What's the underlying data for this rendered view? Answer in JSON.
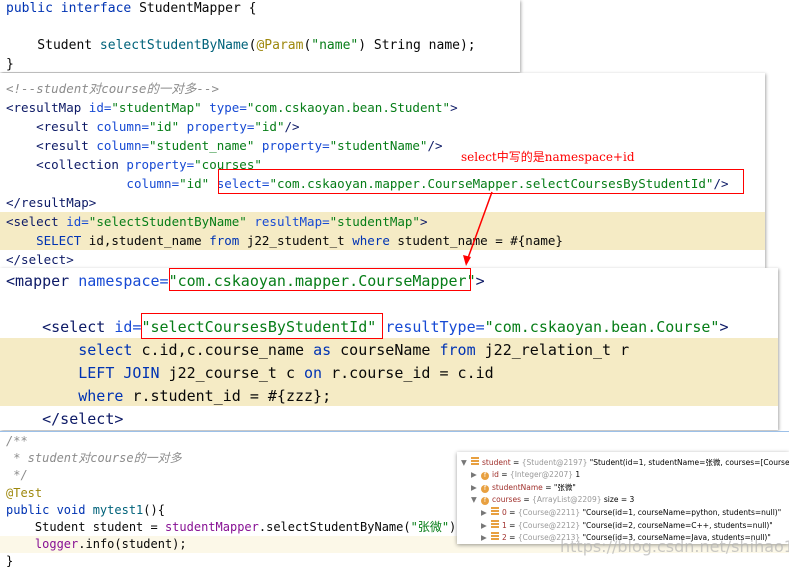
{
  "panels": [
    {
      "id": "java-interface",
      "lines": [
        [
          [
            "public interface ",
            "k"
          ],
          [
            "StudentMapper {",
            "p"
          ]
        ],
        [],
        [
          [
            "    Student ",
            "p"
          ],
          [
            "selectStudentByName",
            "m"
          ],
          [
            "(",
            "p"
          ],
          [
            "@Param",
            "an"
          ],
          [
            "(",
            "p"
          ],
          [
            "\"name\"",
            "s"
          ],
          [
            ") String name);",
            "p"
          ]
        ],
        [
          [
            "}",
            "p"
          ]
        ]
      ]
    },
    {
      "id": "xml-resultmap",
      "lines": [
        [
          [
            "<!--student对course的一对多-->",
            "c"
          ]
        ],
        [
          [
            "<resultMap ",
            "t"
          ],
          [
            "id=",
            "a"
          ],
          [
            "\"studentMap\" ",
            "s"
          ],
          [
            "type=",
            "a"
          ],
          [
            "\"com.cskaoyan.bean.Student\"",
            "s"
          ],
          [
            ">",
            "t"
          ]
        ],
        [
          [
            "    <result ",
            "t"
          ],
          [
            "column=",
            "a"
          ],
          [
            "\"id\" ",
            "s"
          ],
          [
            "property=",
            "a"
          ],
          [
            "\"id\"",
            "s"
          ],
          [
            "/>",
            "t"
          ]
        ],
        [
          [
            "    <result ",
            "t"
          ],
          [
            "column=",
            "a"
          ],
          [
            "\"student_name\" ",
            "s"
          ],
          [
            "property=",
            "a"
          ],
          [
            "\"studentName\"",
            "s"
          ],
          [
            "/>",
            "t"
          ]
        ],
        [
          [
            "    <collection ",
            "t"
          ],
          [
            "property=",
            "a"
          ],
          [
            "\"courses\"",
            "s"
          ]
        ],
        [
          [
            "                ",
            "p"
          ],
          [
            "column=",
            "a"
          ],
          [
            "\"id\" ",
            "s"
          ],
          [
            "select=",
            "a"
          ],
          [
            "\"com.cskaoyan.mapper.CourseMapper.selectCoursesByStudentId\"",
            "s"
          ],
          [
            "/>",
            "t"
          ]
        ],
        [
          [
            "</resultMap>",
            "t"
          ]
        ],
        [
          [
            "<select ",
            "t"
          ],
          [
            "id=",
            "a"
          ],
          [
            "\"selectStudentByName\" ",
            "s"
          ],
          [
            "resultMap=",
            "a"
          ],
          [
            "\"studentMap\"",
            "s"
          ],
          [
            ">",
            "t"
          ]
        ],
        [
          [
            "    SELECT ",
            "k"
          ],
          [
            "id,student_name ",
            "p"
          ],
          [
            "from ",
            "k"
          ],
          [
            "j22_student_t ",
            "p"
          ],
          [
            "where ",
            "k"
          ],
          [
            "student_name = #{name}",
            "p"
          ]
        ],
        [
          [
            "</select>",
            "t"
          ]
        ]
      ]
    },
    {
      "id": "xml-course-mapper",
      "lines": [
        [
          [
            "<mapper ",
            "t"
          ],
          [
            "namespace=",
            "a"
          ],
          [
            "\"com.cskaoyan.mapper.CourseMapper\"",
            "s"
          ],
          [
            ">",
            "t"
          ]
        ],
        [],
        [
          [
            "    <select ",
            "t"
          ],
          [
            "id=",
            "a"
          ],
          [
            "\"selectCoursesByStudentId\" ",
            "s"
          ],
          [
            "resultType=",
            "a"
          ],
          [
            "\"com.cskaoyan.bean.Course\"",
            "s"
          ],
          [
            ">",
            "t"
          ]
        ],
        [
          [
            "        select ",
            "k"
          ],
          [
            "c.id,c.course_name ",
            "p"
          ],
          [
            "as ",
            "k"
          ],
          [
            "courseName ",
            "p"
          ],
          [
            "from ",
            "k"
          ],
          [
            "j22_relation_t r",
            "p"
          ]
        ],
        [
          [
            "        LEFT JOIN ",
            "k"
          ],
          [
            "j22_course_t c ",
            "p"
          ],
          [
            "on ",
            "k"
          ],
          [
            "r.course_id = c.id",
            "p"
          ]
        ],
        [
          [
            "        where ",
            "k"
          ],
          [
            "r.student_id = #{zzz};",
            "p"
          ]
        ],
        [
          [
            "    </select>",
            "t"
          ]
        ]
      ]
    },
    {
      "id": "java-test",
      "lines": [
        [
          [
            "/**",
            "c"
          ]
        ],
        [
          [
            " * student对course的一对多",
            "c"
          ]
        ],
        [
          [
            " */",
            "c"
          ]
        ],
        [
          [
            "@Test",
            "an"
          ]
        ],
        [
          [
            "public void ",
            "k"
          ],
          [
            "mytest1",
            "m"
          ],
          [
            "(){",
            "p"
          ]
        ],
        [
          [
            "    Student student = ",
            "p"
          ],
          [
            "studentMapper",
            "f"
          ],
          [
            ".selectStudentByName(",
            "p"
          ],
          [
            "\"张微\"",
            "s"
          ],
          [
            ");",
            "p"
          ]
        ],
        [
          [
            "    ",
            "p"
          ],
          [
            "logger",
            "f"
          ],
          [
            ".info(student);",
            "p"
          ]
        ],
        [
          [
            "}",
            "p"
          ]
        ]
      ]
    }
  ],
  "annotation": "select中写的是namespace+id",
  "debugger": {
    "rows": [
      {
        "expand": "▼",
        "icon": "obj",
        "name": "student",
        "ref": "{Student@2197}",
        "value": "\"Student(id=1, studentName=张微, courses=[Course(id=1,"
      },
      {
        "expand": "▶",
        "icon": "f",
        "name": "id",
        "ref": "{Integer@2207}",
        "value": "1"
      },
      {
        "expand": "▶",
        "icon": "f",
        "name": "studentName",
        "ref": "",
        "value": "\"张微\""
      },
      {
        "expand": "▼",
        "icon": "f",
        "name": "courses",
        "ref": "{ArrayList@2209}",
        "value": "size = 3"
      },
      {
        "expand": "▶",
        "icon": "obj",
        "name": "0",
        "ref": "{Course@2211}",
        "value": "\"Course(id=1, courseName=python, students=null)\""
      },
      {
        "expand": "▶",
        "icon": "obj",
        "name": "1",
        "ref": "{Course@2212}",
        "value": "\"Course(id=2, courseName=C++, students=null)\""
      },
      {
        "expand": "▶",
        "icon": "obj",
        "name": "2",
        "ref": "{Course@2213}",
        "value": "\"Course(id=3, courseName=Java, students=null)\""
      }
    ]
  },
  "watermark": "https://blog.csdn.net/shihao1998"
}
